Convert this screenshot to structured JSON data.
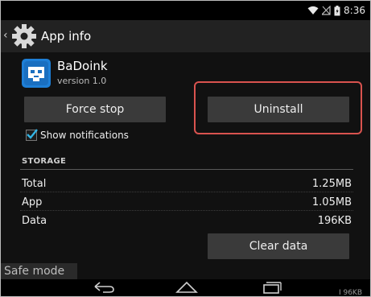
{
  "status_bar": {
    "time": "8:36",
    "icons": [
      "wifi-icon",
      "signal-icon",
      "battery-icon"
    ]
  },
  "action_bar": {
    "title": "App info",
    "back_icon": "chevron-left-icon",
    "app_icon": "settings-gear-icon"
  },
  "app": {
    "name": "BaDoink",
    "version": "version 1.0",
    "icon": "badoink-app-icon"
  },
  "buttons": {
    "force_stop": "Force stop",
    "uninstall": "Uninstall",
    "clear_data": "Clear data"
  },
  "notifications": {
    "label": "Show notifications",
    "checked": true
  },
  "storage": {
    "header": "STORAGE",
    "rows": [
      {
        "label": "Total",
        "value": "1.25MB"
      },
      {
        "label": "App",
        "value": "1.05MB"
      },
      {
        "label": "Data",
        "value": "196KB"
      }
    ]
  },
  "safe_mode": "Safe mode",
  "nav": {
    "buttons": [
      "back-icon",
      "home-icon",
      "recents-icon"
    ],
    "peek_text": "I 96KB"
  },
  "colors": {
    "highlight": "#d9534f",
    "checkbox_accent": "#33b5e5",
    "app_icon_bg": "#1e7fd6"
  }
}
